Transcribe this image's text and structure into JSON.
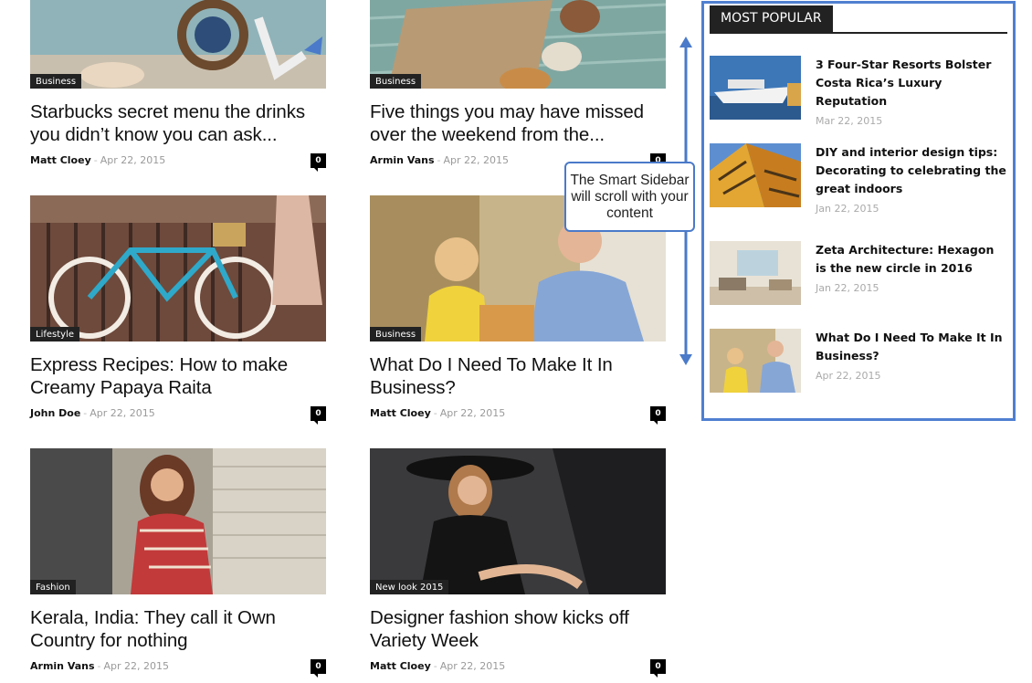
{
  "posts": [
    {
      "category": "Business",
      "title": "Starbucks secret menu the drinks you didn’t know you can ask...",
      "author": "Matt Cloey",
      "date": "Apr 22, 2015",
      "comments": "0"
    },
    {
      "category": "Business",
      "title": "Five things you may have missed over the weekend from the...",
      "author": "Armin Vans",
      "date": "Apr 22, 2015",
      "comments": "0"
    },
    {
      "category": "Lifestyle",
      "title": "Express Recipes: How to make Creamy Papaya Raita",
      "author": "John Doe",
      "date": "Apr 22, 2015",
      "comments": "0"
    },
    {
      "category": "Business",
      "title": "What Do I Need To Make It In Business?",
      "author": "Matt Cloey",
      "date": "Apr 22, 2015",
      "comments": "0"
    },
    {
      "category": "Fashion",
      "title": "Kerala, India: They call it Own Country for nothing",
      "author": "Armin Vans",
      "date": "Apr 22, 2015",
      "comments": "0"
    },
    {
      "category": "New look 2015",
      "title": "Designer fashion show kicks off Variety Week",
      "author": "Matt Cloey",
      "date": "Apr 22, 2015",
      "comments": "0"
    }
  ],
  "annotation": {
    "text": "The Smart Sidebar will scroll with your content"
  },
  "sidebar": {
    "heading": "MOST POPULAR",
    "items": [
      {
        "title": "3 Four-Star Resorts Bolster Costa Rica’s Luxury Reputation",
        "date": "Mar 22, 2015"
      },
      {
        "title": "DIY and interior design tips: Decorating to celebrating the great indoors",
        "date": "Jan 22, 2015"
      },
      {
        "title": "Zeta Architecture: Hexagon is the new circle in 2016",
        "date": "Jan 22, 2015"
      },
      {
        "title": "What Do I Need To Make It In Business?",
        "date": "Apr 22, 2015"
      }
    ]
  },
  "colors": {
    "accent": "#4f7fd0",
    "dark": "#222222",
    "muted": "#9a9a9a"
  }
}
